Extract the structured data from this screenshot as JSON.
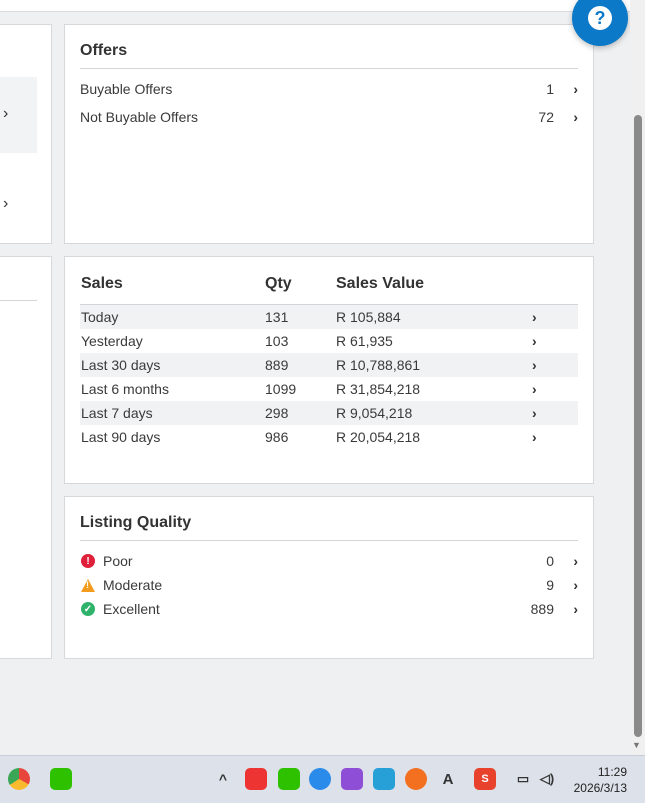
{
  "offers": {
    "title": "Offers",
    "rows": [
      {
        "label": "Buyable Offers",
        "value": "1"
      },
      {
        "label": "Not Buyable Offers",
        "value": "72"
      }
    ]
  },
  "sales": {
    "headers": {
      "sales": "Sales",
      "qty": "Qty",
      "value": "Sales Value"
    },
    "rows": [
      {
        "period": "Today",
        "qty": "131",
        "value": "R 105,884"
      },
      {
        "period": "Yesterday",
        "qty": "103",
        "value": "R 61,935"
      },
      {
        "period": "Last 30 days",
        "qty": "889",
        "value": "R 10,788,861"
      },
      {
        "period": "Last 6 months",
        "qty": "1099",
        "value": "R 31,854,218"
      },
      {
        "period": "Last 7 days",
        "qty": "298",
        "value": "R 9,054,218"
      },
      {
        "period": "Last 90 days",
        "qty": "986",
        "value": "R 20,054,218"
      }
    ]
  },
  "quality": {
    "title": "Listing Quality",
    "rows": [
      {
        "label": "Poor",
        "value": "0",
        "icon": "error-circle-icon",
        "color": "#e0203a"
      },
      {
        "label": "Moderate",
        "value": "9",
        "icon": "warning-triangle-icon",
        "color": "#f29b1d"
      },
      {
        "label": "Excellent",
        "value": "889",
        "icon": "check-circle-icon",
        "color": "#2fb36a"
      }
    ]
  },
  "help": {
    "symbol": "?",
    "color": "#0b79c7"
  },
  "taskbar": {
    "time": "11:29",
    "date": "2026/3/13",
    "caret": "^"
  },
  "chevron": "›"
}
